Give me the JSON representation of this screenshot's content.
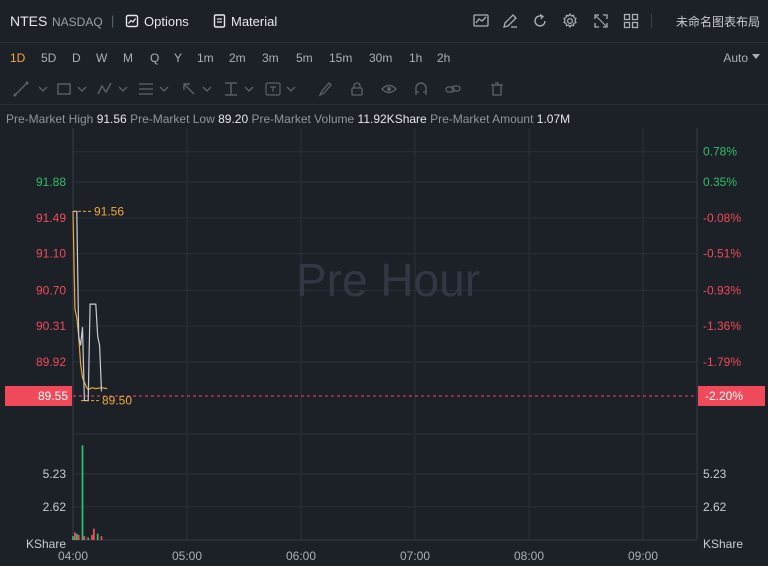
{
  "header": {
    "ticker": "NTES",
    "exchange": "NASDAQ",
    "separator": "|",
    "options_label": "Options",
    "material_label": "Material",
    "layout_name": "未命名图表布局"
  },
  "periods": [
    "1D",
    "5D",
    "D",
    "W",
    "M",
    "Q",
    "Y",
    "1m",
    "2m",
    "3m",
    "5m",
    "15m",
    "30m",
    "1h",
    "2h"
  ],
  "active_period": "1D",
  "scale_mode": "Auto",
  "info": {
    "high_label": "Pre-Market High",
    "high_value": "91.56",
    "low_label": "Pre-Market Low",
    "low_value": "89.20",
    "volume_label": "Pre-Market Volume",
    "volume_value": "11.92KShare",
    "amount_label": "Pre-Market Amount",
    "amount_value": "1.07M"
  },
  "watermark": "Pre Hour",
  "colors": {
    "up": "#2fbf6a",
    "down": "#f04a5a",
    "line": "#e8a83a",
    "accent": "#f0a93a",
    "badge": "#f04a5a"
  },
  "chart_data": {
    "type": "line",
    "price_axis": {
      "ylim": [
        89.1,
        92.0
      ],
      "ticks": [
        {
          "value": 91.88,
          "label": "91.88",
          "color": "up"
        },
        {
          "value": 91.49,
          "label": "91.49",
          "color": "down"
        },
        {
          "value": 91.1,
          "label": "91.10",
          "color": "down"
        },
        {
          "value": 90.7,
          "label": "90.70",
          "color": "down"
        },
        {
          "value": 90.31,
          "label": "90.31",
          "color": "down"
        },
        {
          "value": 89.92,
          "label": "89.92",
          "color": "down"
        }
      ]
    },
    "percent_axis": {
      "ticks": [
        {
          "value": 92.21,
          "label": "0.78%",
          "color": "up"
        },
        {
          "value": 91.88,
          "label": "0.35%",
          "color": "up"
        },
        {
          "value": 91.49,
          "label": "-0.08%",
          "color": "down"
        },
        {
          "value": 91.1,
          "label": "-0.51%",
          "color": "down"
        },
        {
          "value": 90.7,
          "label": "-0.93%",
          "color": "down"
        },
        {
          "value": 90.31,
          "label": "-1.36%",
          "color": "down"
        },
        {
          "value": 89.92,
          "label": "-1.79%",
          "color": "down"
        }
      ]
    },
    "current": {
      "price": 89.55,
      "label": "89.55",
      "percent_label": "-2.20%"
    },
    "high_marker": {
      "value": 91.56,
      "label": "91.56"
    },
    "low_marker": {
      "value": 89.5,
      "label": "89.50"
    },
    "x_axis": {
      "start": "04:00",
      "end": "09:30",
      "ticks": [
        "04:00",
        "05:00",
        "06:00",
        "07:00",
        "08:00",
        "09:00"
      ]
    },
    "series": [
      {
        "name": "price",
        "color": "line",
        "x": [
          "04:00",
          "04:01",
          "04:02",
          "04:03",
          "04:04",
          "04:05",
          "04:06",
          "04:07",
          "04:08",
          "04:10",
          "04:12",
          "04:15",
          "04:18"
        ],
        "values": [
          91.56,
          90.5,
          90.4,
          90.2,
          89.9,
          89.75,
          89.7,
          89.65,
          89.62,
          89.64,
          89.63,
          89.64,
          89.63
        ]
      },
      {
        "name": "average",
        "color": "#c8ccd2",
        "x": [
          "04:00",
          "04:01",
          "04:02",
          "04:03",
          "04:04",
          "04:05",
          "04:06",
          "04:07",
          "04:08",
          "04:09",
          "04:10",
          "04:11",
          "04:12",
          "04:13",
          "04:14",
          "04:15"
        ],
        "values": [
          91.56,
          91.56,
          91.56,
          90.2,
          90.1,
          90.3,
          89.5,
          89.5,
          89.5,
          90.55,
          90.55,
          90.55,
          90.55,
          90.2,
          90.1,
          89.6
        ]
      }
    ],
    "volume_axis": {
      "ylim": [
        0,
        8.0
      ],
      "ticks": [
        {
          "value": 5.23,
          "label": "5.23"
        },
        {
          "value": 2.62,
          "label": "2.62"
        }
      ],
      "unit": "KShare"
    },
    "volume": {
      "x": [
        "04:00",
        "04:01",
        "04:02",
        "04:03",
        "04:05",
        "04:06",
        "04:08",
        "04:10",
        "04:11",
        "04:13",
        "04:15"
      ],
      "values": [
        0.3,
        0.6,
        0.5,
        0.4,
        7.5,
        0.3,
        0.2,
        0.4,
        0.9,
        0.5,
        0.3
      ],
      "colors": [
        "up",
        "down",
        "up",
        "down",
        "up",
        "down",
        "up",
        "down",
        "down",
        "up",
        "down"
      ]
    },
    "grid": true
  }
}
